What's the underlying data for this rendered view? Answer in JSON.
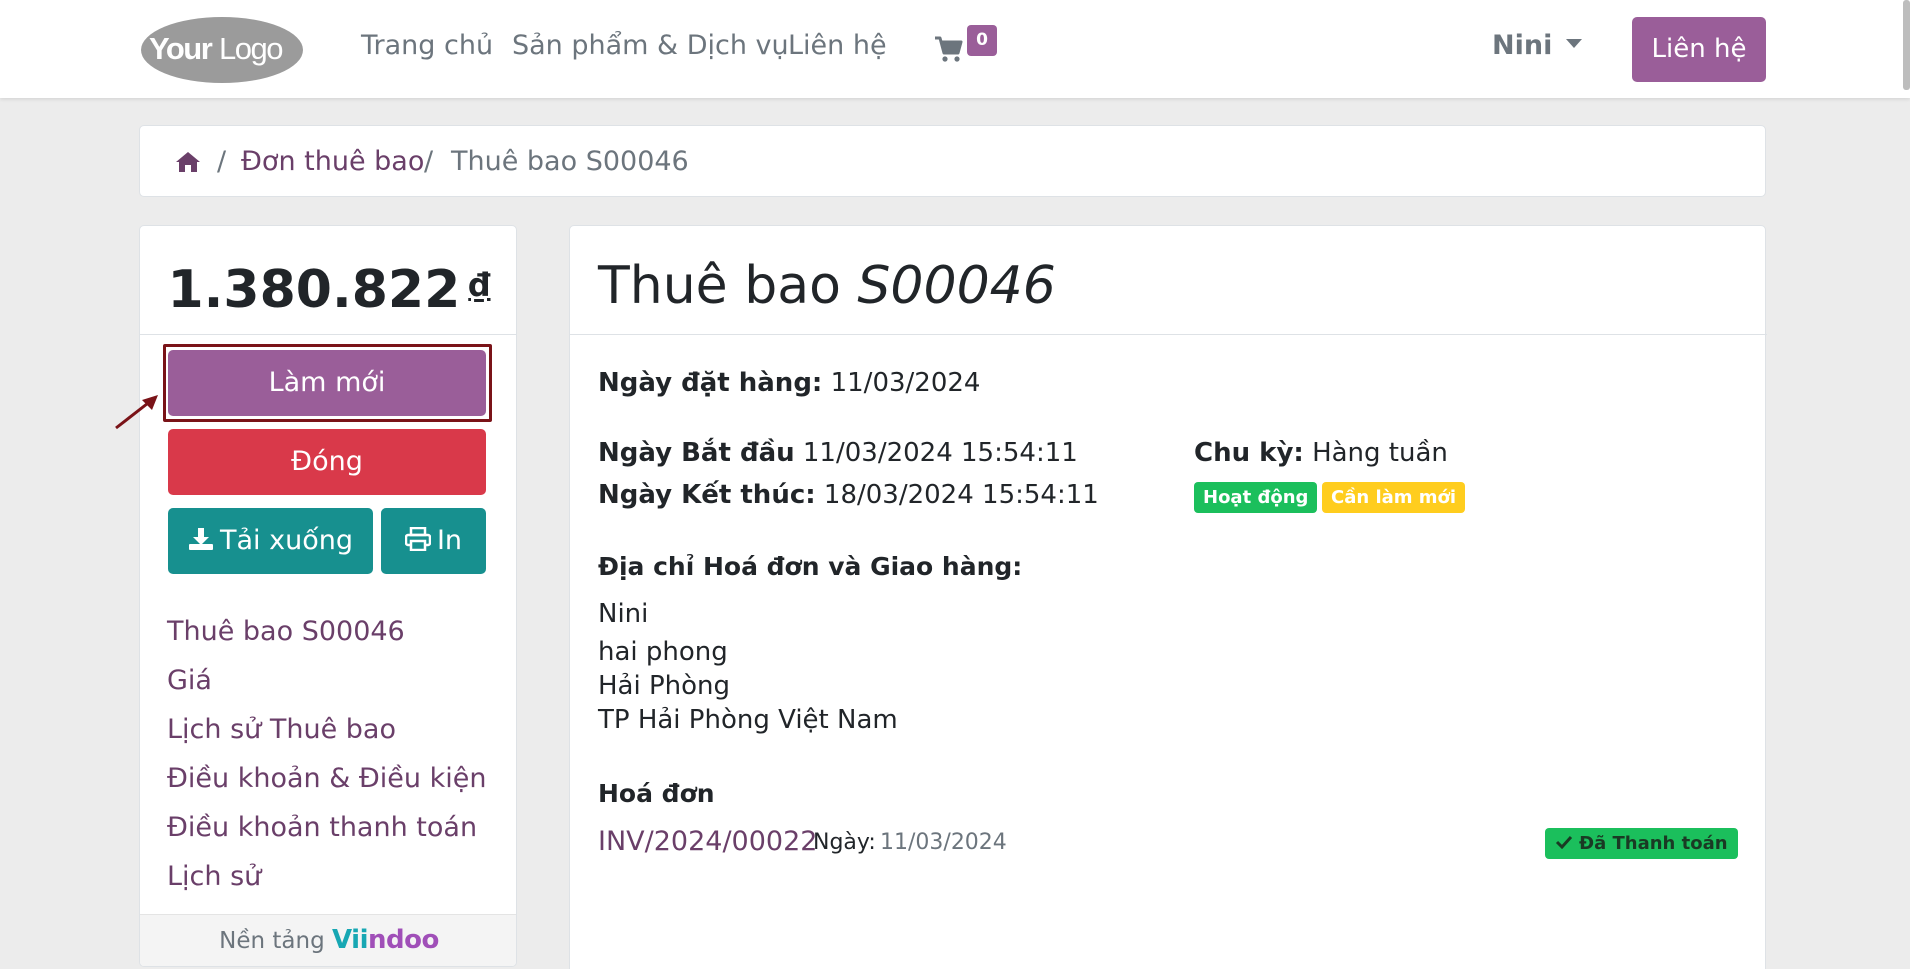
{
  "navbar": {
    "logo_text_bold": "Your",
    "logo_text_light": "Logo",
    "links": [
      "Trang chủ",
      "Sản phẩm & Dịch vụ",
      "Liên hệ"
    ],
    "cart_count": "0",
    "user_name": "Nini",
    "contact_button": "Liên hệ"
  },
  "breadcrumb": {
    "sep1": "/",
    "link": "Đơn thuê bao",
    "sep2": "/",
    "current": "Thuê bao S00046"
  },
  "sidebar": {
    "amount": "1.380.822",
    "currency": "₫",
    "renew_button": "Làm mới",
    "close_button": "Đóng",
    "download_button": "Tải xuống",
    "print_button": "In",
    "links": [
      "Thuê bao S00046",
      "Giá",
      "Lịch sử Thuê bao",
      "Điều khoản & Điều kiện",
      "Điều khoản thanh toán",
      "Lịch sử"
    ],
    "footer_label": "Nền tảng",
    "footer_brand_a": "Vii",
    "footer_brand_b": "ndoo"
  },
  "main": {
    "title_prefix": "Thuê bao",
    "title_code": "S00046",
    "order_date_label": "Ngày đặt hàng:",
    "order_date": "11/03/2024",
    "start_label": "Ngày Bắt đầu",
    "start_value": "11/03/2024 15:54:11",
    "end_label": "Ngày Kết thúc:",
    "end_value": "18/03/2024 15:54:11",
    "cycle_label": "Chu kỳ:",
    "cycle_value": "Hàng tuần",
    "status_active": "Hoạt động",
    "status_renew": "Cần làm mới",
    "address_heading": "Địa chỉ Hoá đơn và Giao hàng:",
    "address_lines": [
      "Nini",
      "hai phong",
      "Hải Phòng",
      "TP Hải Phòng Việt Nam"
    ],
    "invoice_heading": "Hoá đơn",
    "invoice_number": "INV/2024/00022",
    "invoice_date_label": "Ngày:",
    "invoice_date": "11/03/2024",
    "invoice_status": "Đã Thanh toán"
  },
  "colors": {
    "brand": "#9a5e99",
    "danger": "#d9394a",
    "teal": "#17908f",
    "success": "#1bbf5c",
    "warning": "#ffcd1e",
    "link": "#6a3f69"
  }
}
